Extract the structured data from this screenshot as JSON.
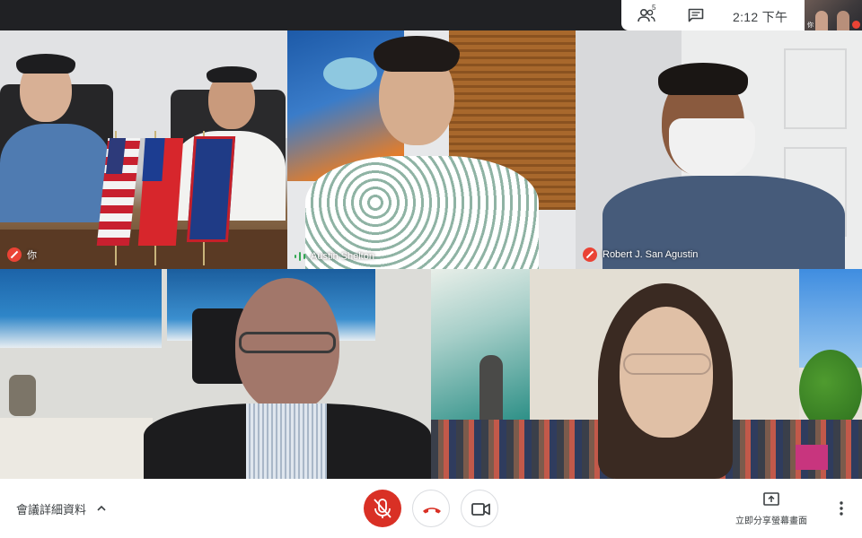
{
  "topbar": {
    "participant_count": "5",
    "clock": "2:12 下午"
  },
  "self_view": {
    "label": "你"
  },
  "tiles": [
    {
      "name": "你",
      "muted": true
    },
    {
      "name": "Austin Shelton",
      "muted": false,
      "speaking": true
    },
    {
      "name": "Robert J. San Agustin",
      "muted": true
    },
    {
      "name": "",
      "muted": false
    },
    {
      "name": "",
      "muted": false
    }
  ],
  "bottombar": {
    "meeting_details": "會議詳細資料",
    "present_now": "立即分享螢幕畫面"
  },
  "colors": {
    "accent_red": "#d93025",
    "mute_red": "#ea4335",
    "speaking_green": "#34a853"
  }
}
